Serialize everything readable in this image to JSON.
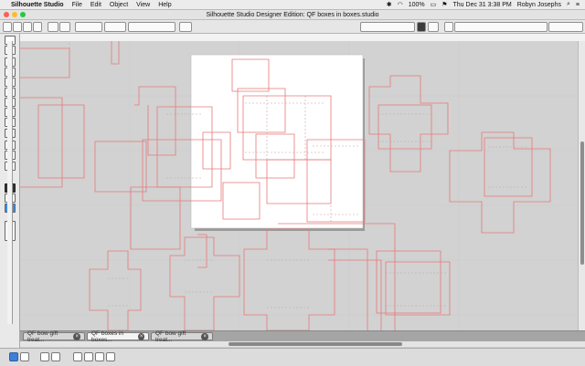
{
  "menubar": {
    "app_name": "Silhouette Studio",
    "menus": [
      "File",
      "Edit",
      "Object",
      "View",
      "Help"
    ],
    "battery": "100%",
    "clock": "Thu Dec 31  3:38 PM",
    "user": "Robyn Josephs"
  },
  "window": {
    "title": "Silhouette Studio Designer Edition: QF boxes in boxes.studio"
  },
  "tabs": [
    {
      "label": "QF bow gift treat..."
    },
    {
      "label": "QF boxes in boxes..."
    },
    {
      "label": "QF bow gift treat..."
    }
  ],
  "colors": {
    "cut_line": "#e87878",
    "fold_line": "#c6a3a3",
    "page": "#ffffff",
    "canvas": "#d2d2d2"
  }
}
